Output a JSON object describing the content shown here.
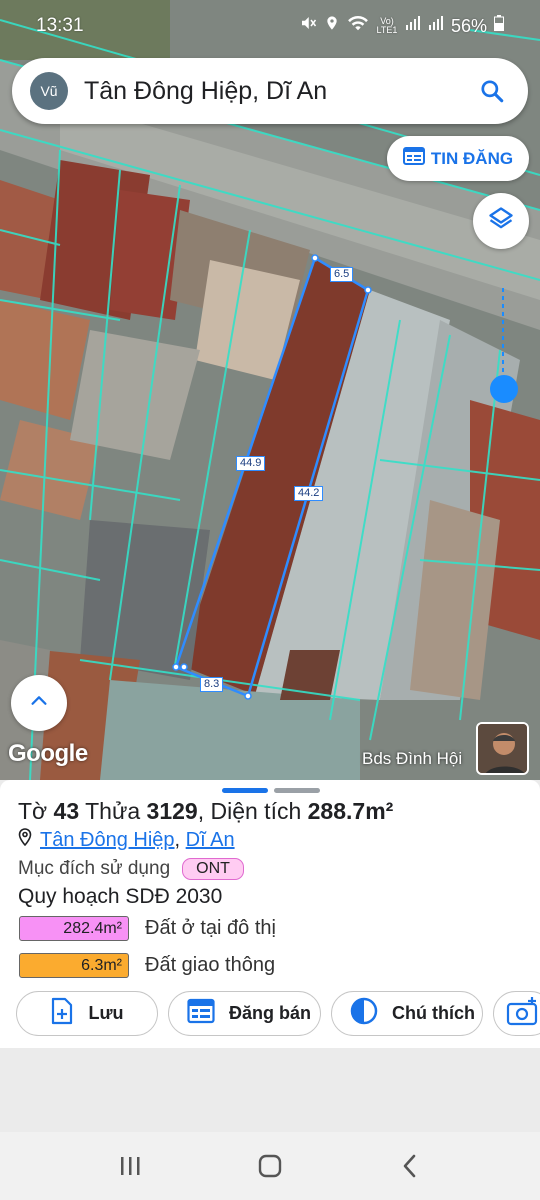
{
  "status": {
    "time": "13:31",
    "battery": "56%",
    "network": "Vo) LTE1"
  },
  "search": {
    "avatar_letter": "Vũ",
    "query": "Tân Đông Hiệp, Dĩ An",
    "search_icon": "search-icon"
  },
  "top_buttons": {
    "tin_dang": "TIN ĐĂNG",
    "layers_icon": "layers-icon"
  },
  "map": {
    "measurements": [
      "6.5",
      "44.9",
      "44.2",
      "8.3"
    ],
    "watermark": "Google",
    "owner_name": "Bds Đình Hội",
    "plot_line_color": "#2f8cff",
    "boundary_color": "#34e0c8"
  },
  "parcel": {
    "sheet_label": "Tờ",
    "sheet_no": "43",
    "parcel_label": "Thửa",
    "parcel_no": "3129",
    "area_label": "Diện tích",
    "area_value": "288.7m²",
    "ward": "Tân Đông Hiệp",
    "city": "Dĩ An",
    "purpose_label": "Mục đích sử dụng",
    "purpose_code": "ONT",
    "planning_title": "Quy hoạch SDĐ 2030",
    "planning": [
      {
        "area": "282.4m²",
        "label": "Đất ở tại đô thị",
        "color": "#f791f5"
      },
      {
        "area": "6.3m²",
        "label": "Đất giao thông",
        "color": "#fbab2f"
      }
    ]
  },
  "actions": {
    "save": "Lưu",
    "sell": "Đăng bán",
    "legend": "Chú thích"
  }
}
